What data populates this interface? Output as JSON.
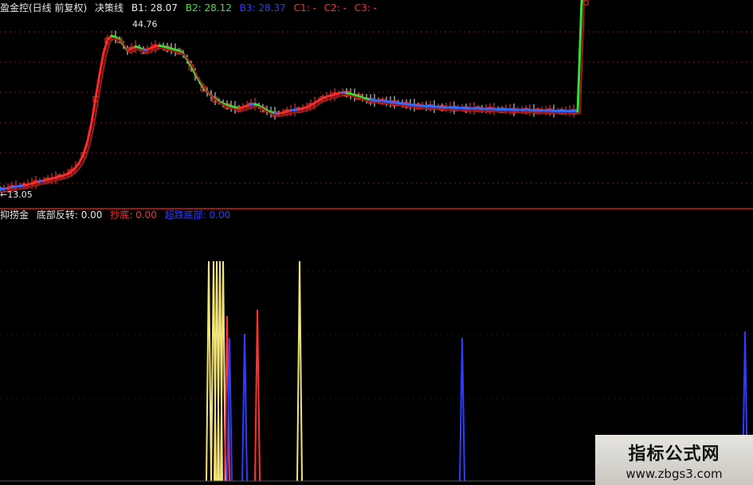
{
  "price_panel": {
    "title": "盈金控(日线 前复权)",
    "indicator_name": "决策线",
    "values": [
      {
        "label": "B1: 28.07",
        "color": "#e8e8e8"
      },
      {
        "label": "B2: 28.12",
        "color": "#3ce63c"
      },
      {
        "label": "B3: 28.37",
        "color": "#2f3cff"
      },
      {
        "label": "C1: -",
        "color": "#ff3030"
      },
      {
        "label": "C2: -",
        "color": "#ff3030"
      },
      {
        "label": "C3: -",
        "color": "#ff3030"
      }
    ],
    "high_label": "44.76",
    "low_label": "←13.05"
  },
  "indicator_panel": {
    "title": "抑捞金",
    "values": [
      {
        "label": "底部反转: 0.00",
        "color": "#e8e8e8"
      },
      {
        "label": "抄底: 0.00",
        "color": "#ff3030"
      },
      {
        "label": "超跌底部: 0.00",
        "color": "#2f3cff"
      }
    ]
  },
  "chart_data": [
    {
      "type": "line",
      "title": "决策线",
      "ylim": [
        13.05,
        44.76
      ],
      "x": [
        0,
        5,
        10,
        15,
        20,
        25,
        30,
        35,
        40,
        45,
        50,
        55,
        60,
        65,
        70,
        75,
        80,
        85,
        90,
        95,
        100,
        105,
        110,
        115,
        120,
        125,
        130,
        135,
        140,
        145,
        150,
        155,
        160,
        165,
        170,
        175,
        180,
        185,
        190,
        195,
        200,
        205,
        210,
        215,
        220,
        225,
        230,
        235,
        240,
        245,
        250,
        255,
        260,
        265,
        270,
        275,
        280,
        285,
        290,
        295,
        300,
        305,
        310,
        315,
        320,
        325,
        330,
        335,
        340,
        345,
        350,
        355,
        360,
        365,
        370,
        375,
        380,
        385,
        390,
        395,
        400,
        405,
        410,
        415,
        420,
        425,
        430,
        435,
        440,
        445,
        450,
        455,
        460,
        465,
        470,
        475,
        480,
        485,
        490,
        495,
        500,
        505,
        510,
        515,
        520,
        525,
        530,
        535,
        540,
        545,
        550,
        555,
        560,
        565,
        570,
        575,
        580,
        585,
        590,
        595,
        600,
        605,
        610,
        615,
        620,
        625,
        630,
        635,
        640,
        645,
        650,
        655,
        660,
        665,
        670,
        675,
        680,
        685,
        690,
        695,
        700,
        705,
        710,
        715,
        720,
        725,
        730,
        735
      ],
      "series": [
        {
          "name": "B1",
          "color": "#e8e8e8",
          "values": [
            13.4,
            13.5,
            13.6,
            13.8,
            13.9,
            14.0,
            14.1,
            14.3,
            14.5,
            14.7,
            14.9,
            15.0,
            15.2,
            15.4,
            15.6,
            15.8,
            16.0,
            16.3,
            16.8,
            17.5,
            18.5,
            20.0,
            22.5,
            26.0,
            30.5,
            35.0,
            39.0,
            41.5,
            42.2,
            42.0,
            41.5,
            40.5,
            39.5,
            39.8,
            40.2,
            40.0,
            39.5,
            39.6,
            40.0,
            40.2,
            40.4,
            40.2,
            40.0,
            39.8,
            39.6,
            39.4,
            38.8,
            37.8,
            36.5,
            35.0,
            33.8,
            32.5,
            31.7,
            31.0,
            30.4,
            29.9,
            29.5,
            29.2,
            29.0,
            28.8,
            28.6,
            28.8,
            29.1,
            29.3,
            29.4,
            29.1,
            28.6,
            28.2,
            27.9,
            27.7,
            27.6,
            27.8,
            28.0,
            28.2,
            28.3,
            28.4,
            28.6,
            28.8,
            29.2,
            29.6,
            30.1,
            30.5,
            30.8,
            31.0,
            31.2,
            31.4,
            31.6,
            31.5,
            31.3,
            31.1,
            30.9,
            30.6,
            30.4,
            30.2,
            30.1,
            30.0,
            30.0,
            29.9,
            29.8,
            29.7,
            29.6,
            29.5,
            29.4,
            29.3,
            29.2,
            29.1,
            29.1,
            29.0,
            29.0,
            28.9,
            28.9,
            28.8,
            28.8,
            28.8,
            28.7,
            28.7,
            28.7,
            28.6,
            28.6,
            28.6,
            28.6,
            28.5,
            28.5,
            28.5,
            28.5,
            28.4,
            28.4,
            28.4,
            28.4,
            28.3,
            28.3,
            28.3,
            28.3,
            28.3,
            28.2,
            28.2,
            28.2,
            28.2,
            28.2,
            28.1,
            28.1,
            28.1,
            28.1,
            28.1,
            28.1,
            28.07
          ]
        }
      ]
    },
    {
      "type": "line",
      "title": "抑捞金",
      "ylim": [
        0,
        100
      ],
      "series": [
        {
          "name": "底部反转",
          "color": "#f2e27a",
          "spikes": [
            [
              262,
              100
            ],
            [
              268,
              100
            ],
            [
              272,
              100
            ],
            [
              276,
              100
            ],
            [
              280,
              100
            ],
            [
              376,
              100
            ]
          ]
        },
        {
          "name": "抄底",
          "color": "#ff3030",
          "spikes": [
            [
              323,
              78
            ],
            [
              285,
              75
            ]
          ]
        },
        {
          "name": "超跌底部",
          "color": "#2f3cff",
          "spikes": [
            [
              307,
              67
            ],
            [
              288,
              65
            ],
            [
              580,
              65
            ],
            [
              935,
              68
            ]
          ]
        }
      ]
    }
  ],
  "watermark": {
    "line1": "指标公式网",
    "line2": "www.zbgs3.com"
  }
}
